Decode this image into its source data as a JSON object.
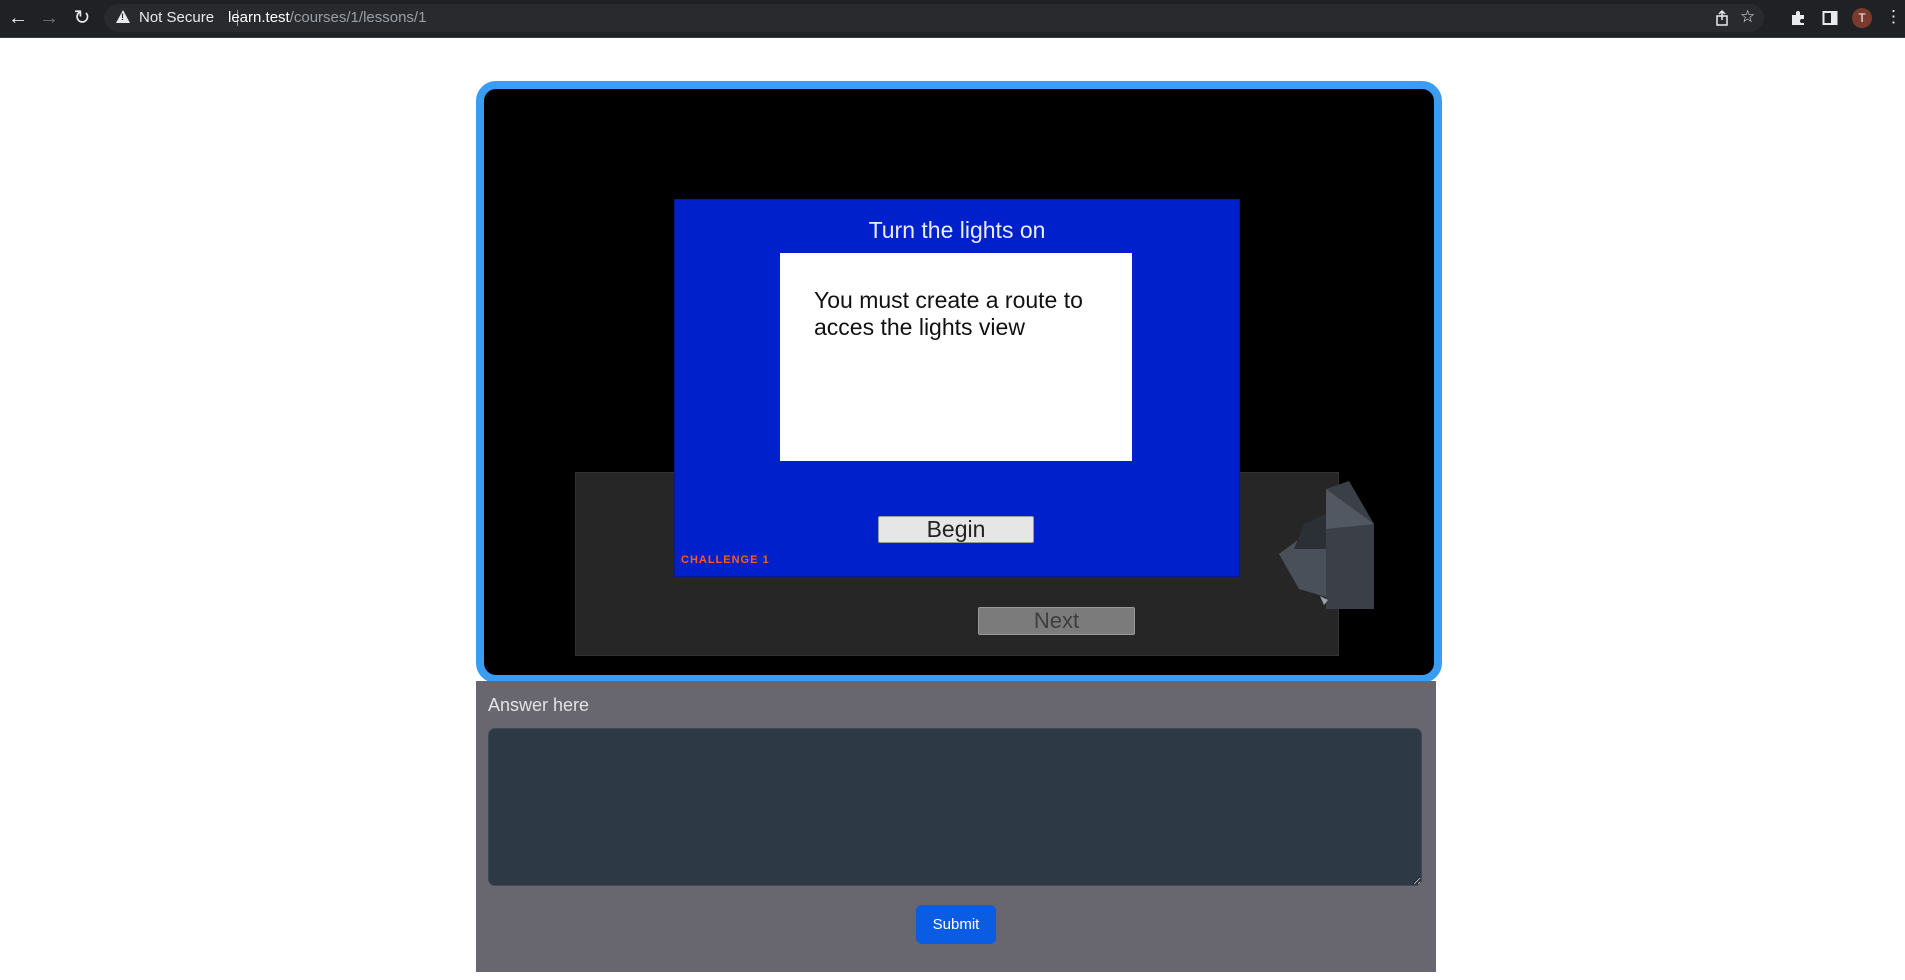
{
  "browser": {
    "security_label": "Not Secure",
    "url_host": "learn.test",
    "url_path": "/courses/1/lessons/1",
    "avatar_initial": "T"
  },
  "game": {
    "dialog_title": "Turn the lights on",
    "dialog_text": "You must create a route to acces the lights view",
    "begin_label": "Begin",
    "challenge_label": "CHALLENGE 1",
    "next_label": "Next"
  },
  "answer": {
    "label": "Answer here",
    "value": "",
    "submit_label": "Submit"
  },
  "colors": {
    "frame_border": "#3b9cf3",
    "dialog_background": "#0020cc",
    "challenge_label": "#ff5a1a",
    "submit_button": "#0a5ce3",
    "answer_panel": "#686770",
    "answer_input": "#2d3a46"
  },
  "icons": [
    "back-icon",
    "forward-icon",
    "reload-icon",
    "warning-icon",
    "share-icon",
    "star-icon",
    "extensions-icon",
    "side-panel-icon",
    "menu-icon"
  ]
}
